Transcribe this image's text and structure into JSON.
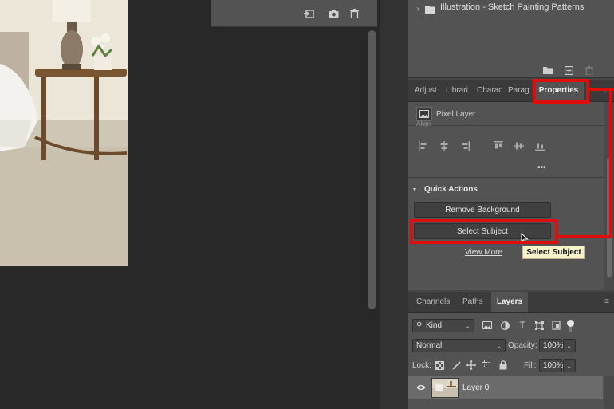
{
  "libraries": {
    "expand_icon": "chevron-right-icon",
    "folder_icon": "folder-icon",
    "library_name": "Illustration - Sketch Painting Patterns",
    "footer_icons": [
      "new-folder-icon",
      "add-icon",
      "trash-icon"
    ]
  },
  "top_strip": {
    "icons": [
      "import-icon",
      "camera-icon",
      "trash-icon"
    ]
  },
  "properties_tabs": [
    "Adjust",
    "Librari",
    "Charac",
    "Parag",
    "Properties"
  ],
  "properties": {
    "layer_type": "Pixel Layer",
    "align_label": "Align:",
    "more_label": "•••",
    "quick_actions_title": "Quick Actions",
    "remove_background": "Remove Background",
    "select_subject": "Select Subject",
    "view_more": "View More",
    "tooltip": "Select Subject"
  },
  "layers_tabs": [
    "Channels",
    "Paths",
    "Layers"
  ],
  "layers": {
    "filter_kind": "Kind",
    "blend_mode": "Normal",
    "opacity_label": "Opacity:",
    "opacity_value": "100%",
    "lock_label": "Lock:",
    "fill_label": "Fill:",
    "fill_value": "100%",
    "layer_name": "Layer 0"
  },
  "colors": {
    "highlight": "#e00d0d",
    "tooltip_bg": "#f6f3c9"
  }
}
